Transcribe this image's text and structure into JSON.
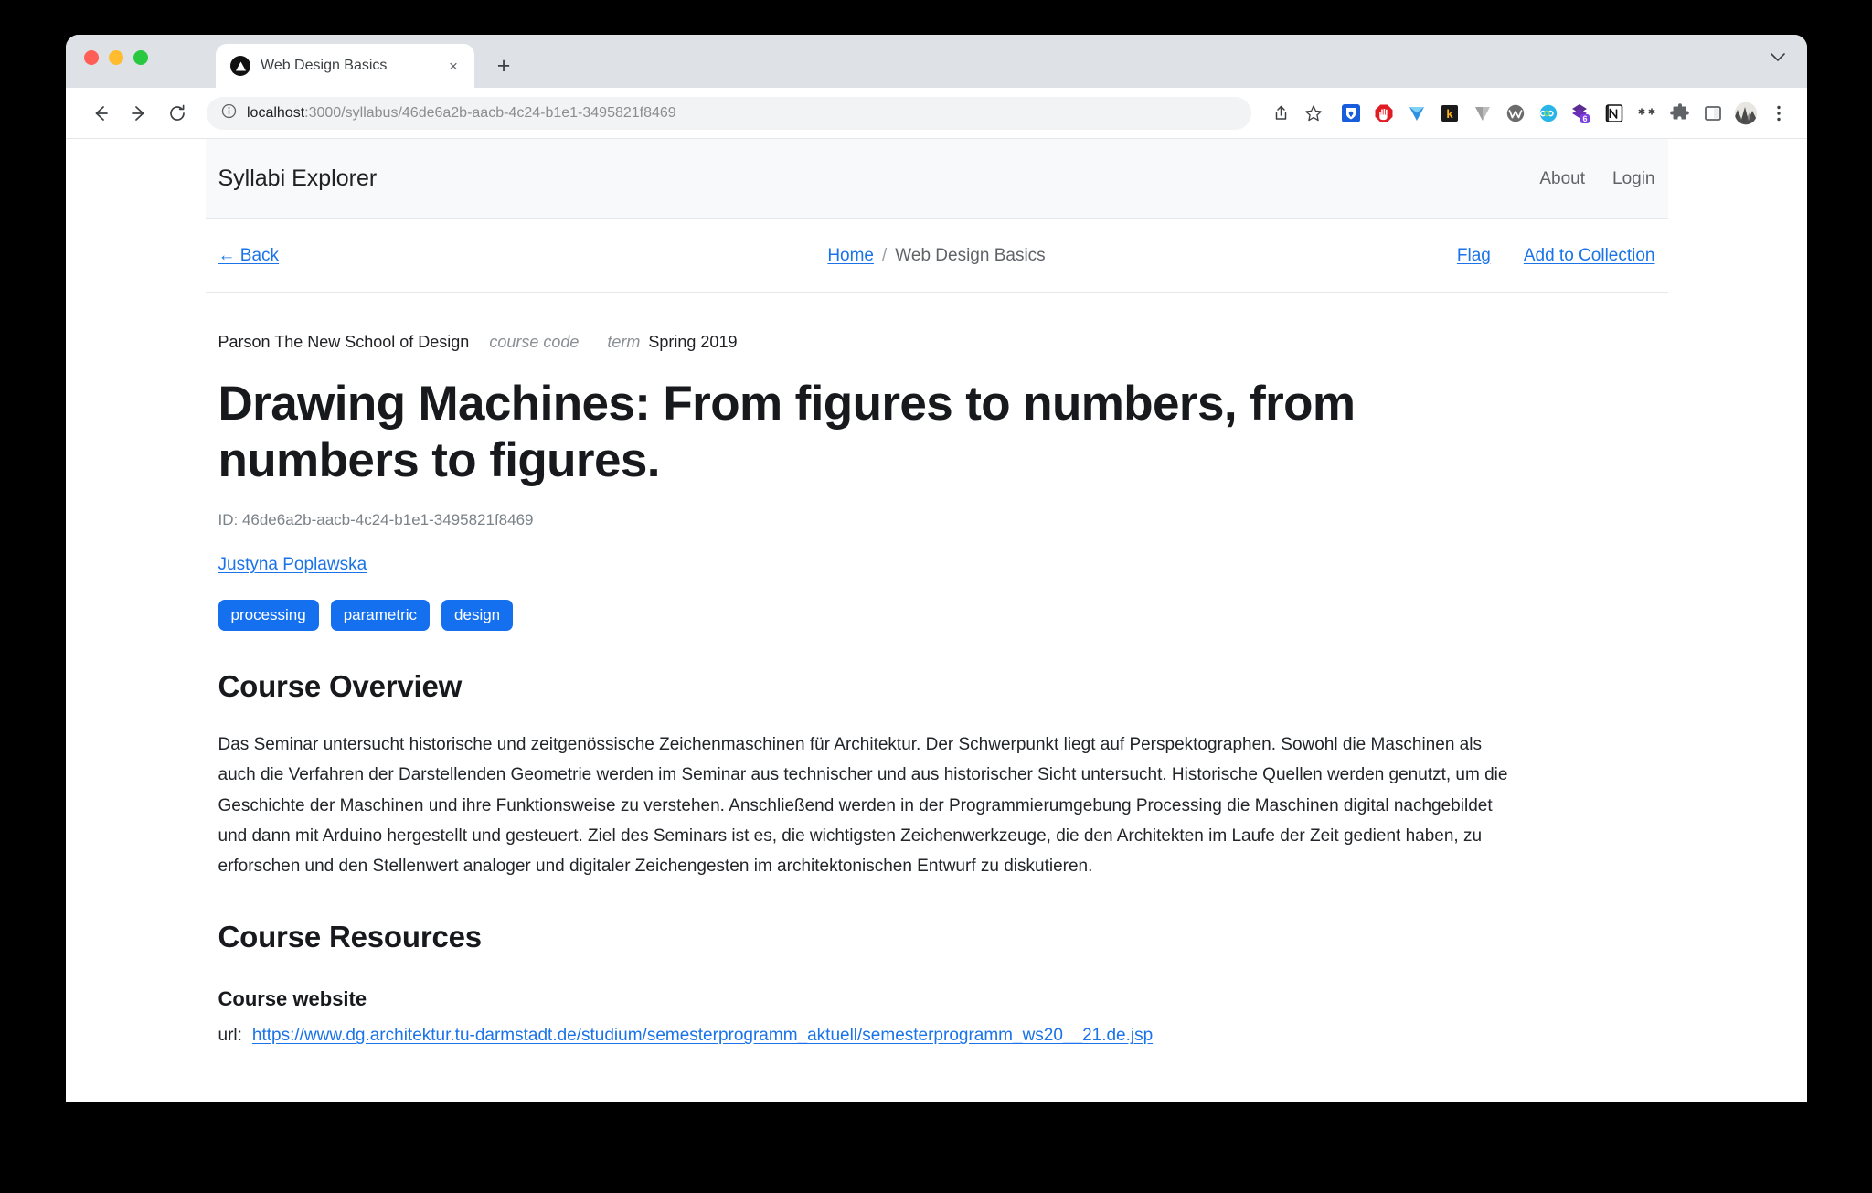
{
  "browser": {
    "tab": {
      "title": "Web Design Basics",
      "favicon": "triangle-logo-icon",
      "close": "×"
    },
    "new_tab_label": "+",
    "tabstrip_collapse": "⌄",
    "nav": {
      "back": "←",
      "forward": "→",
      "reload": "⟳"
    },
    "omnibox": {
      "info_icon": "site-info-icon",
      "url_host": "localhost",
      "url_rest": ":3000/syllabus/46de6a2b-aacb-4c24-b1e1-3495821f8469",
      "share_icon": "share-icon",
      "bookmark_icon": "star-icon"
    },
    "extensions": [
      "bitwarden-icon",
      "adblock-icon",
      "honey-icon",
      "kagi-icon",
      "vimium-icon",
      "wallabag-icon",
      "coil-icon",
      "roam-icon",
      "notion-icon",
      "asterisk-icon",
      "puzzle-extensions-icon",
      "sidepanel-icon"
    ],
    "extension_badge": "6",
    "avatar": "profile-avatar",
    "menu_icon": "kebab-menu-icon"
  },
  "site": {
    "brand": "Syllabi Explorer",
    "nav": [
      {
        "label": "About"
      },
      {
        "label": "Login"
      }
    ]
  },
  "action_bar": {
    "back_label": "← Back",
    "breadcrumb": {
      "home": "Home",
      "separator": "/",
      "current": "Web Design Basics"
    },
    "flag_label": "Flag",
    "add_to_collection_label": "Add to Collection"
  },
  "syllabus": {
    "institution": "Parson The New School of Design",
    "course_code_label": "course code",
    "course_code_value": "",
    "term_label": "term",
    "term_value": "Spring 2019",
    "title": "Drawing Machines: From figures to numbers, from numbers to figures.",
    "id_line": "ID: 46de6a2b-aacb-4c24-b1e1-3495821f8469",
    "author": "Justyna Poplawska",
    "tags": [
      "processing",
      "parametric",
      "design"
    ],
    "overview_heading": "Course Overview",
    "overview_text": "Das Seminar untersucht historische und zeitgenössische Zeichenmaschinen für Architektur. Der Schwerpunkt liegt auf Perspektographen. Sowohl die Maschinen als auch die Verfahren der Darstellenden Geometrie werden im Seminar aus technischer und aus historischer Sicht untersucht. Historische Quellen werden genutzt, um die Geschichte der Maschinen und ihre Funktionsweise zu verstehen. Anschließend werden in der Programmierumgebung Processing die Maschinen digital nachgebildet und dann mit Arduino hergestellt und gesteuert. Ziel des Seminars ist es, die wichtigsten Zeichenwerkzeuge, die den Architekten im Laufe der Zeit gedient haben, zu erforschen und den Stellenwert analoger und digitaler Zeichengesten im architektonischen Entwurf zu diskutieren.",
    "resources_heading": "Course Resources",
    "resource_name": "Course website",
    "resource_url_label": "url:",
    "resource_url": "https://www.dg.architektur.tu-darmstadt.de/studium/semesterprogramm_aktuell/semesterprogramm_ws20__21.de.jsp"
  },
  "colors": {
    "link": "#1a73e8",
    "tag_bg": "#1570f0",
    "header_bg": "#f8f9fa",
    "text": "#212529"
  }
}
